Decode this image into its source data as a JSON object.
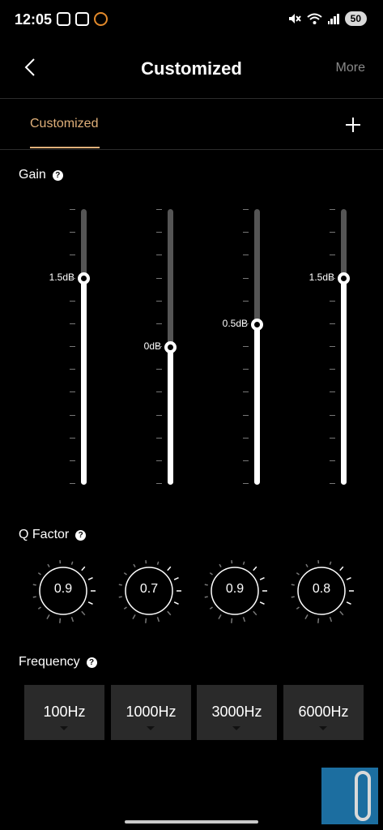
{
  "status_bar": {
    "time": "12:05",
    "battery": "50"
  },
  "header": {
    "title": "Customized",
    "more_label": "More"
  },
  "tabs": [
    {
      "label": "Customized",
      "active": true
    }
  ],
  "gain": {
    "label": "Gain",
    "bands": [
      {
        "label": "1.5dB",
        "level": 0.75
      },
      {
        "label": "0dB",
        "level": 0.5
      },
      {
        "label": "0.5dB",
        "level": 0.583
      },
      {
        "label": "1.5dB",
        "level": 0.75
      }
    ]
  },
  "q_factor": {
    "label": "Q Factor",
    "knobs": [
      {
        "value": "0.9"
      },
      {
        "value": "0.7"
      },
      {
        "value": "0.9"
      },
      {
        "value": "0.8"
      }
    ]
  },
  "frequency": {
    "label": "Frequency",
    "options": [
      {
        "value": "100Hz"
      },
      {
        "value": "1000Hz"
      },
      {
        "value": "3000Hz"
      },
      {
        "value": "6000Hz"
      }
    ]
  },
  "colors": {
    "accent": "#e0b07a",
    "background": "#000000",
    "track": "#555555"
  }
}
